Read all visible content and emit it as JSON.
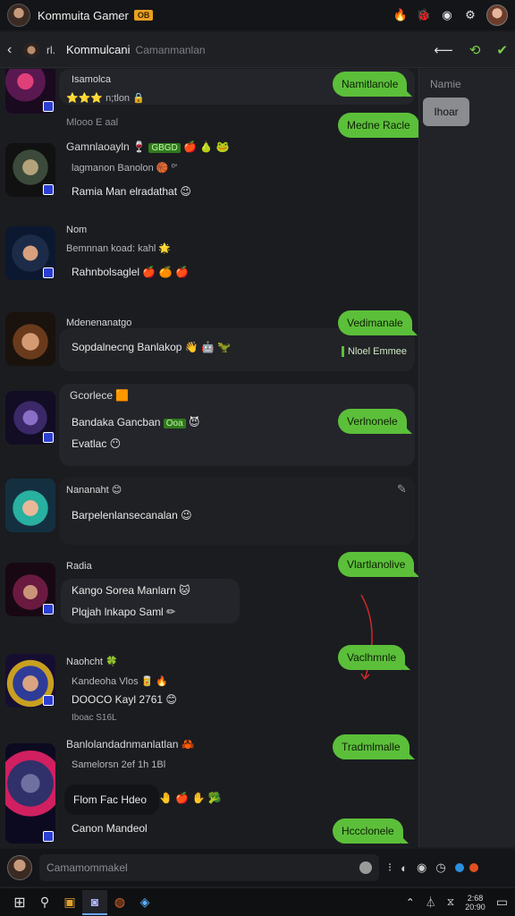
{
  "titlebar": {
    "title": "Kommuita Gamer",
    "badge": "OB",
    "icons": [
      "fire-icon",
      "bug-icon",
      "discord-icon",
      "gear-icon"
    ]
  },
  "header": {
    "back": "‹",
    "number": "rl.",
    "name": "Kommulcani",
    "subtitle": "Camanmanlan"
  },
  "sidepanel": {
    "label": "Namie",
    "button": "Ihoar"
  },
  "messages": [
    {
      "name": "Isamolca",
      "line1": "⭐⭐⭐ n;tlon 🔒",
      "meta": "Mlooo E aal",
      "pill": "Namitlanole",
      "pill2": "Medne Racle"
    },
    {
      "name": "Gamnlaoayln 🍷",
      "green": "GBGD",
      "emo": "🍎 🍐 🐸",
      "line1": "lagmanon Banolon 🏀 ⁰'",
      "line2": "Ramia Man elradathat 😉"
    },
    {
      "name": "Nom",
      "line1": "Bemnnan koad: kahl 🌟",
      "line2": "Rahnbolsaglel 🍎 🍊 🍎"
    },
    {
      "name": "Mdenenanatgo",
      "line1": "Sopdalnecng Banlakop 👋 🤖 🦖",
      "pill": "Vedimanale",
      "flat": "Nloel Emmee"
    },
    {
      "name": "Gcorlece 🟧",
      "line1": "Bandaka Gancban",
      "green": "Ooa",
      "emo": "😈",
      "line2": "Evatlac 😶",
      "pill": "Verlnonele"
    },
    {
      "name": "Nananaht 😊",
      "line1": "Barpelenlansecanalan 😉"
    },
    {
      "name": "Radia",
      "line1": "Kango Sorea Manlarn 🐱",
      "line2": "Plqjah lnkapo Saml ✏",
      "pill": "Vlartlanolive"
    },
    {
      "name": "Naohcht 🍀",
      "line1": "Kandeoha Vlos 🥫 🔥",
      "line2": "DOOCO Kayl 2761 😊",
      "line3": "Iboac S16L",
      "pill": "Vaclhmnle"
    },
    {
      "name": "Banlolandadnmanlatlan 🦀",
      "line1": "Samelorsn 2ef 1h 1Bl",
      "line2": "Flom Fac Hdeo",
      "emo": "🤚 🍎 ✋ 🥦",
      "line3": "Canon Mandeol",
      "pill": "Tradmlmalle",
      "pill2": "Hccclonele"
    }
  ],
  "input": {
    "placeholder": "Camamommakel"
  },
  "taskbar": {
    "time": "2:68",
    "date": "20:90"
  }
}
